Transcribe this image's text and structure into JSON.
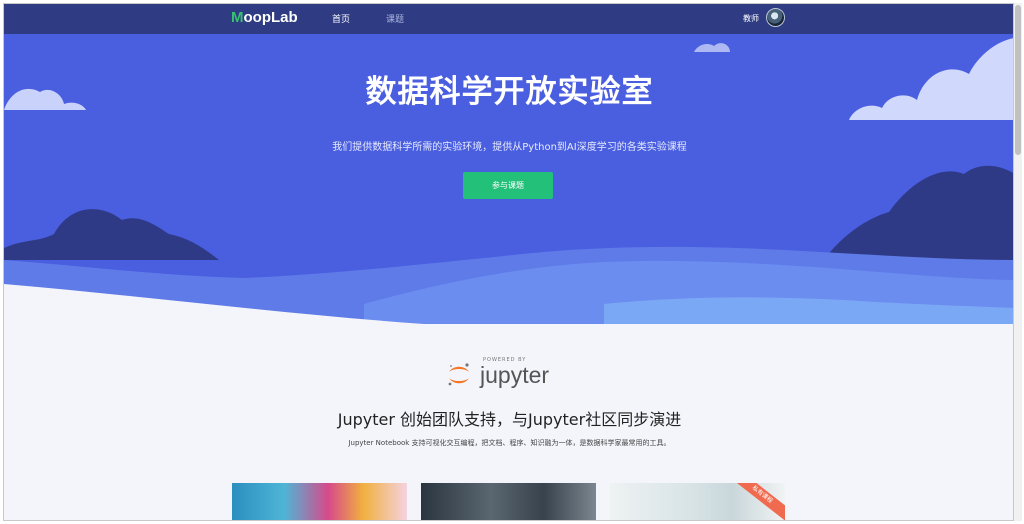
{
  "nav": {
    "logo_m": "M",
    "logo_rest": "oopLab",
    "links": [
      {
        "label": "首页"
      },
      {
        "label": "课题"
      }
    ],
    "user_name": "教师"
  },
  "hero": {
    "title": "数据科学开放实验室",
    "subtitle": "我们提供数据科学所需的实验环境，提供从Python到AI深度学习的各类实验课程",
    "cta_label": "参与课题"
  },
  "jupyter_section": {
    "powered_by": "POWERED BY",
    "logo_word": "jupyter",
    "title": "Jupyter 创始团队支持，与Jupyter社区同步演进",
    "description": "Jupyter Notebook 支持可视化交互编程，把文档、程序、知识融为一体，是数据科学家最常用的工具。"
  },
  "cards": {
    "ribbon_label": "私有课程"
  },
  "colors": {
    "nav_bg": "#2f3c84",
    "hero_bg": "#4a5ee0",
    "accent_green": "#23c07a",
    "logo_green": "#35c26f",
    "jupyter_orange": "#f37726"
  }
}
